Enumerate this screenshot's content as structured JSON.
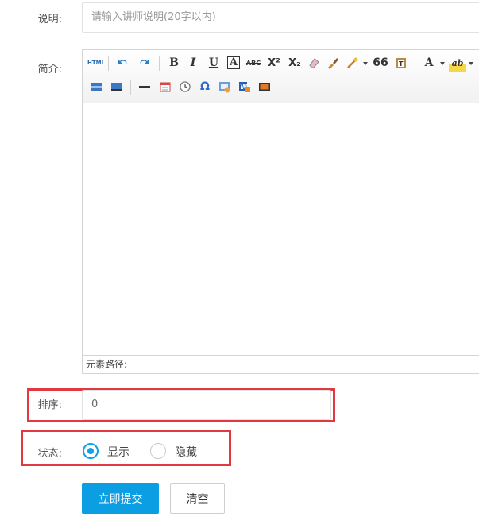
{
  "form": {
    "desc": {
      "label": "说明:",
      "placeholder": "请输入讲师说明(20字以内)"
    },
    "intro": {
      "label": "简介:"
    },
    "editor": {
      "status_path": "元素路径:"
    },
    "sort": {
      "label": "排序:",
      "value": "0"
    },
    "status": {
      "label": "状态:",
      "options": [
        {
          "label": "显示",
          "checked": true
        },
        {
          "label": "隐藏",
          "checked": false
        }
      ]
    },
    "buttons": {
      "submit": "立即提交",
      "reset": "清空"
    }
  },
  "toolbar": {
    "html_label": "HTML",
    "bold": "B",
    "italic": "I",
    "underline": "U",
    "font_border": "A",
    "strikethrough": "ABC",
    "superscript": "X²",
    "subscript": "X₂",
    "blockquote": "66",
    "font_color": "A",
    "highlight": "ab",
    "special_char": "Ω"
  },
  "colors": {
    "primary": "#0b9ee3",
    "highlight_border": "#e0393f",
    "radio_active": "#0fa0e8"
  }
}
